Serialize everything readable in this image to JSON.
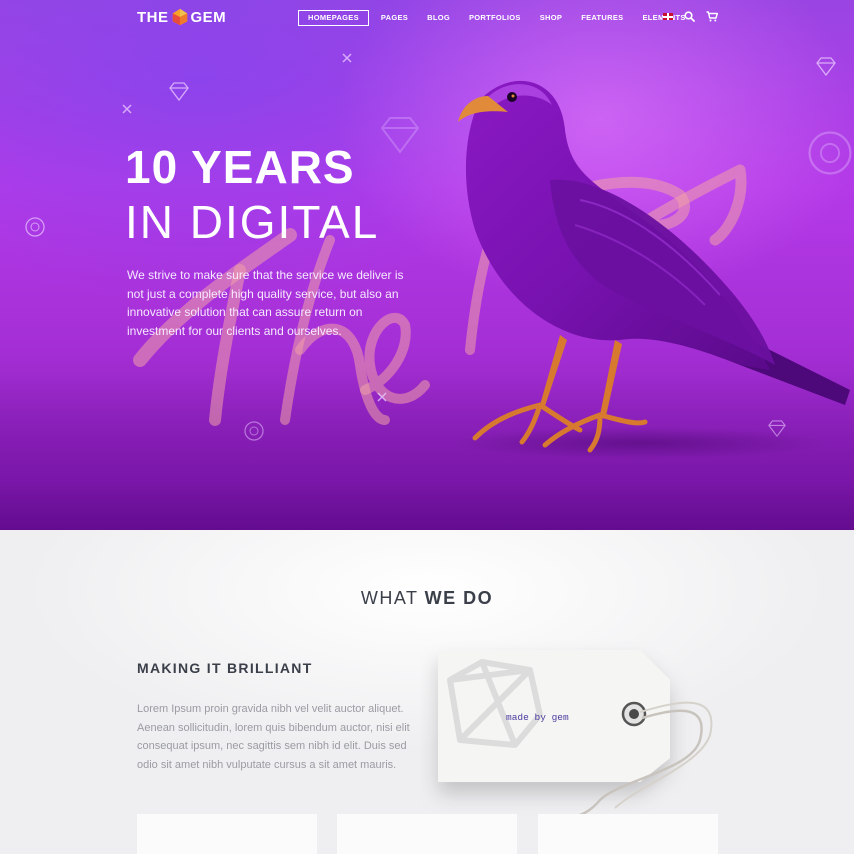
{
  "nav": {
    "logo_left": "THE",
    "logo_right": "GEM",
    "menu": [
      {
        "label": "HOMEPAGES",
        "active": true
      },
      {
        "label": "PAGES"
      },
      {
        "label": "BLOG"
      },
      {
        "label": "PORTFOLIOS"
      },
      {
        "label": "SHOP"
      },
      {
        "label": "FEATURES"
      },
      {
        "label": "ELEMENTS"
      }
    ],
    "icons": [
      "uk-flag-icon",
      "search-icon",
      "cart-icon"
    ]
  },
  "hero": {
    "title_line1": "10 YEARS",
    "title_line2": "IN DIGITAL",
    "description": "We strive to make sure that the service we deliver is not just a complete high quality service, but also an innovative solution that can assure return on investment for our clients and ourselves.",
    "script_text": "The Gem",
    "colors": {
      "accent": "#b43ae8",
      "beak": "#e08a3a"
    }
  },
  "what_we_do": {
    "heading_light": "WHAT",
    "heading_bold": "WE DO",
    "subheading": "MAKING IT BRILLIANT",
    "body": "Lorem Ipsum proin gravida nibh vel velit auctor aliquet. Aenean sollicitudin, lorem quis bibendum auctor, nisi elit consequat ipsum, nec sagittis sem nibh id elit. Duis sed odio sit amet nibh vulputate cursus a sit amet mauris.",
    "tag_text": "made by gem"
  }
}
